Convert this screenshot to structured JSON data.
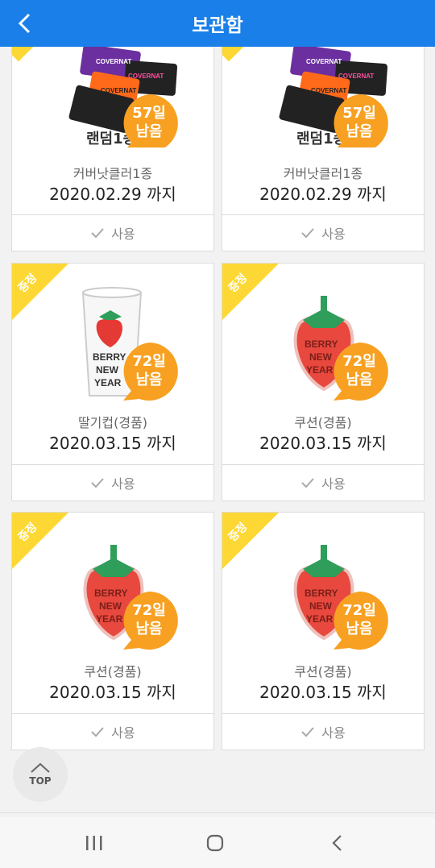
{
  "header": {
    "title": "보관함"
  },
  "cards": [
    {
      "name": "커버낫클러1종",
      "expiry": "2020.02.29 까지",
      "days": "57일",
      "remaining": "남음",
      "use_label": "사용",
      "gift_label": "",
      "product": "covernat"
    },
    {
      "name": "커버낫클러1종",
      "expiry": "2020.02.29 까지",
      "days": "57일",
      "remaining": "남음",
      "use_label": "사용",
      "gift_label": "",
      "product": "covernat"
    },
    {
      "name": "딸기컵(경품)",
      "expiry": "2020.03.15 까지",
      "days": "72일",
      "remaining": "남음",
      "use_label": "사용",
      "gift_label": "증정",
      "product": "cup"
    },
    {
      "name": "쿠션(경품)",
      "expiry": "2020.03.15 까지",
      "days": "72일",
      "remaining": "남음",
      "use_label": "사용",
      "gift_label": "증정",
      "product": "cushion"
    },
    {
      "name": "쿠션(경품)",
      "expiry": "2020.03.15 까지",
      "days": "72일",
      "remaining": "남음",
      "use_label": "사용",
      "gift_label": "증정",
      "product": "cushion"
    },
    {
      "name": "쿠션(경품)",
      "expiry": "2020.03.15 까지",
      "days": "72일",
      "remaining": "남음",
      "use_label": "사용",
      "gift_label": "증정",
      "product": "cushion"
    }
  ],
  "covernat_text": {
    "brand": "COVERNAT",
    "random": "랜덤1종"
  },
  "cup_text": [
    "BERRY",
    "NEW",
    "YEAR"
  ],
  "top_button": {
    "label": "TOP"
  },
  "colors": {
    "header": "#1a7fe8",
    "badge": "#f7a021",
    "ribbon": "#fdd835"
  }
}
